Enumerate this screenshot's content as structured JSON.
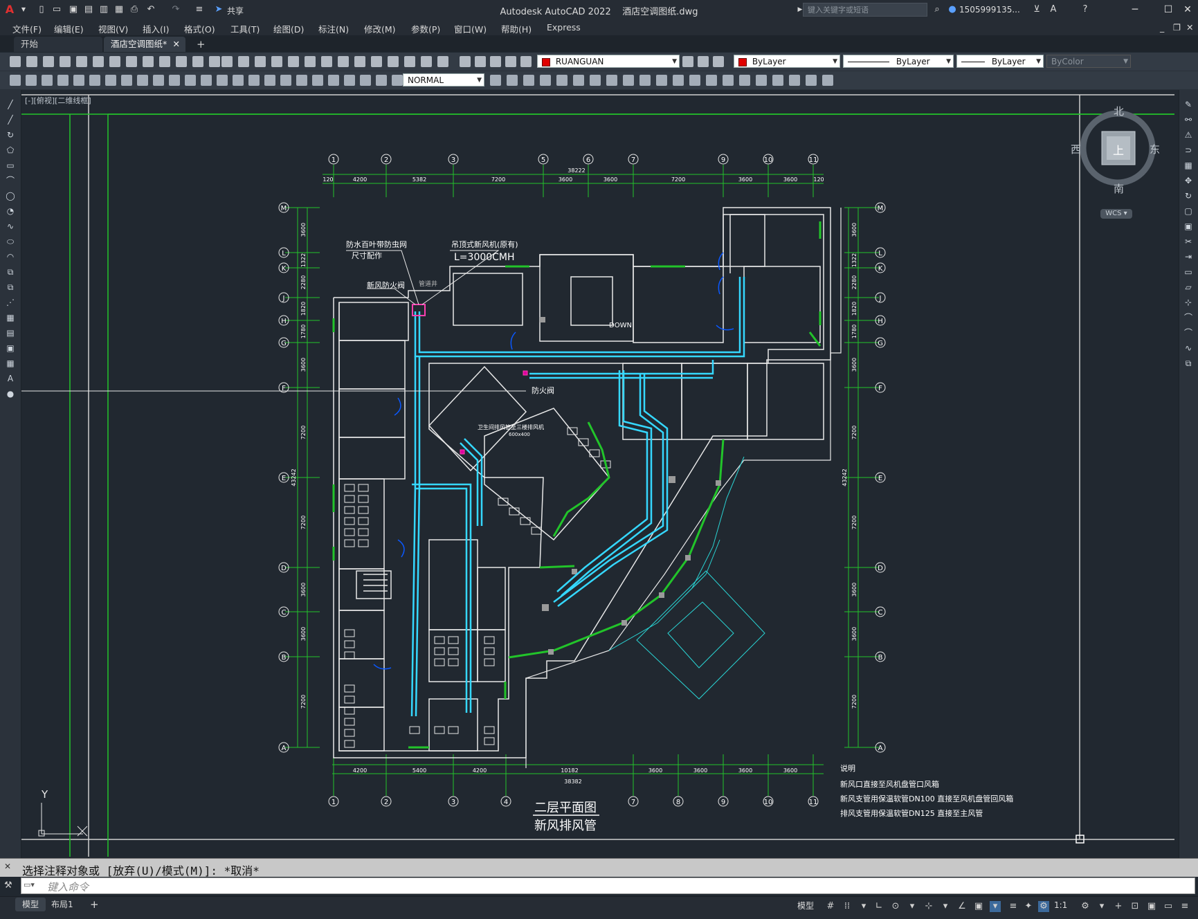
{
  "app": {
    "title": "Autodesk AutoCAD 2022",
    "filename": "酒店空调图纸.dwg",
    "share_label": "共享",
    "search_placeholder": "键入关键字或短语",
    "user": "1505999135..."
  },
  "menu": [
    "文件(F)",
    "编辑(E)",
    "视图(V)",
    "插入(I)",
    "格式(O)",
    "工具(T)",
    "绘图(D)",
    "标注(N)",
    "修改(M)",
    "参数(P)",
    "窗口(W)",
    "帮助(H)",
    "Express"
  ],
  "tabs": {
    "start": "开始",
    "drawing": "酒店空调图纸*"
  },
  "toolbar": {
    "layer_name": "RUANGUAN",
    "color": "ByLayer",
    "linetype": "ByLayer",
    "lineweight": "ByLayer",
    "plotstyle": "ByColor",
    "dimstyle": "NORMAL"
  },
  "viewport_label": "[-][俯视][二维线框]",
  "navcube": {
    "north": "北",
    "south": "南",
    "east": "东",
    "west": "西",
    "top": "上",
    "wcs": "WCS"
  },
  "drawing": {
    "title_main": "二层平面图",
    "title_sub": "新风排风管",
    "notes_heading": "说明",
    "notes": [
      "新风口直接至风机盘管口风箱",
      "新风支管用保温软管DN100 直接至风机盘管回风箱",
      "排风支管用保温软管DN125 直接至主风管"
    ],
    "annotations": {
      "louver": "防水百叶带防虫网",
      "louver_sub": "尺寸配作",
      "fresh_air_unit": "吊顶式新风机(原有)",
      "airflow": "L=3000CMH",
      "fire_damper": "新风防火阀",
      "fire_damper2": "防火阀",
      "shaft": "管道井",
      "down": "DOWN",
      "exhaust_note": "卫生间排风管至三楼排风机",
      "duct_size": "600x400"
    },
    "top_axes": [
      "1",
      "2",
      "3",
      "5",
      "6",
      "7",
      "9",
      "10",
      "11"
    ],
    "bottom_axes": [
      "1",
      "2",
      "3",
      "4",
      "7",
      "8",
      "9",
      "10",
      "11"
    ],
    "row_axes": [
      "M",
      "L",
      "K",
      "J",
      "H",
      "G",
      "F",
      "E",
      "D",
      "C",
      "B",
      "A"
    ],
    "top_dims": [
      "120",
      "4200",
      "5382",
      "7200",
      "3600",
      "3600",
      "7200",
      "3600",
      "3600",
      "120"
    ],
    "top_total": "38222",
    "bottom_dims": [
      "4200",
      "5400",
      "4200",
      "10182",
      "3600",
      "3600",
      "3600",
      "3600"
    ],
    "bottom_total": "38382",
    "side_dims": [
      "3600",
      "1322",
      "2280",
      "1820",
      "1780",
      "3600",
      "7200",
      "7200",
      "3600",
      "3600",
      "7200"
    ],
    "side_total": "43242"
  },
  "ucs": {
    "y_label": "Y"
  },
  "command": {
    "history": "选择注释对象或 [放弃(U)/模式(M)]: *取消*",
    "placeholder": "键入命令"
  },
  "status": {
    "model_tab": "模型",
    "layout_tab": "布局1",
    "model_space": "模型",
    "scale": "1:1"
  }
}
